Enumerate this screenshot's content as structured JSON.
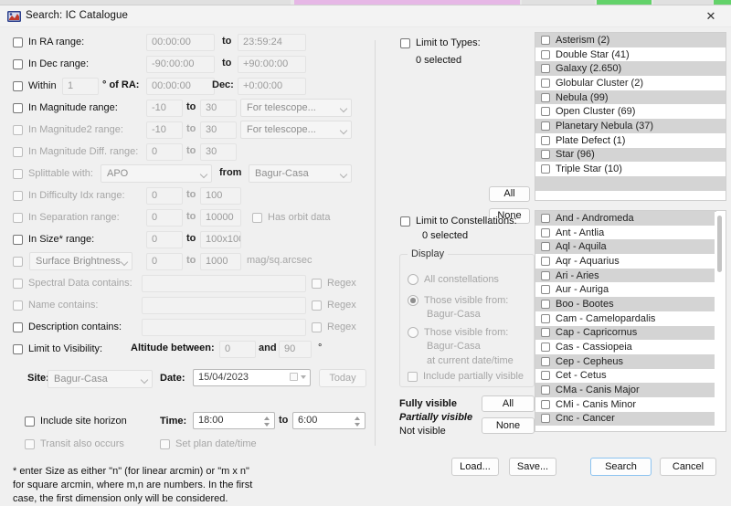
{
  "window": {
    "title": "Search: IC Catalogue",
    "close_label": "✕",
    "app_icon": "catalogue-icon"
  },
  "left": {
    "ra_range": {
      "label": "In RA range:",
      "from": "00:00:00",
      "to_label": "to",
      "to": "23:59:24",
      "enabled": true
    },
    "dec_range": {
      "label": "In Dec range:",
      "from": "-90:00:00",
      "to_label": "to",
      "to": "+90:00:00",
      "enabled": true
    },
    "within": {
      "label": "Within",
      "deg": "1",
      "of_ra_label": "° of RA:",
      "ra": "00:00:00",
      "dec_label": "Dec:",
      "dec": "+0:00:00",
      "enabled": true
    },
    "magnitude": {
      "label": "In Magnitude range:",
      "from": "-10",
      "to_label": "to",
      "to": "30",
      "telescope": "For telescope...",
      "enabled": true
    },
    "magnitude2": {
      "label": "In Magnitude2 range:",
      "from": "-10",
      "to_label": "to",
      "to": "30",
      "telescope": "For telescope...",
      "enabled": false
    },
    "magnitude_diff": {
      "label": "In Magnitude Diff. range:",
      "from": "0",
      "to_label": "to",
      "to": "30",
      "enabled": false
    },
    "splittable": {
      "label": "Splittable with:",
      "scope": "APO",
      "from_label": "from",
      "site": "Bagur-Casa",
      "enabled": false
    },
    "difficulty": {
      "label": "In Difficulty Idx range:",
      "from": "0",
      "to_label": "to",
      "to": "100",
      "enabled": false
    },
    "separation": {
      "label": "In Separation range:",
      "from": "0",
      "to_label": "to",
      "to": "10000",
      "orbit_label": "Has orbit data",
      "enabled": false
    },
    "size": {
      "label": "In Size* range:",
      "from": "0",
      "to_label": "to",
      "to": "100x100",
      "enabled": true
    },
    "surface": {
      "label": "Surface Brightness",
      "from": "0",
      "to_label": "to",
      "to": "1000",
      "units": "mag/sq.arcsec",
      "enabled": false
    },
    "spectral": {
      "label": "Spectral Data contains:",
      "value": "",
      "regex_label": "Regex",
      "enabled": false
    },
    "name": {
      "label": "Name contains:",
      "value": "",
      "regex_label": "Regex",
      "enabled": false
    },
    "description": {
      "label": "Description contains:",
      "value": "",
      "regex_label": "Regex",
      "enabled": true
    },
    "visibility": {
      "label": "Limit to Visibility:",
      "altitude_label": "Altitude between:",
      "alt_min": "0",
      "and_label": "and",
      "alt_max": "90",
      "deg_label": "°",
      "enabled": true
    },
    "site": {
      "label": "Site:",
      "value": "Bagur-Casa"
    },
    "date": {
      "label": "Date:",
      "value": "15/04/2023",
      "today_label": "Today"
    },
    "site_horizon": {
      "label": "Include site horizon",
      "enabled": true
    },
    "time": {
      "label": "Time:",
      "from": "18:00",
      "to_label": "to",
      "to": "6:00"
    },
    "transit": {
      "label": "Transit also occurs",
      "enabled": false
    },
    "set_plan": {
      "label": "Set plan date/time",
      "enabled": false
    },
    "footnote": "* enter Size as either \"n\" (for linear arcmin) or \"m x n\"\nfor square arcmin, where m,n are numbers. In the first\ncase, the first dimension only will be considered."
  },
  "types_panel": {
    "label": "Limit to Types:",
    "selected_text": "0 selected",
    "all_label": "All",
    "none_label": "None",
    "items": [
      "Asterism (2)",
      "Double Star (41)",
      "Galaxy (2.650)",
      "Globular Cluster (2)",
      "Nebula (99)",
      "Open Cluster (69)",
      "Planetary Nebula (37)",
      "Plate Defect (1)",
      "Star (96)",
      "Triple Star (10)"
    ]
  },
  "constellations_panel": {
    "label": "Limit to Constellations:",
    "selected_text": "0 selected",
    "display_group_title": "Display",
    "opt_all": "All constellations",
    "opt_visible_from": "Those visible from:",
    "opt_visible_from_site": "Bagur-Casa",
    "opt_visible_now": "Those visible from:",
    "opt_visible_now_site": "Bagur-Casa",
    "opt_visible_now_sub": "at current date/time",
    "include_partial": "Include partially visible",
    "legend_full": "Fully visible",
    "legend_partial": "Partially visible",
    "legend_not": "Not visible",
    "all_label": "All",
    "none_label": "None",
    "items": [
      "And - Andromeda",
      "Ant - Antlia",
      "Aql - Aquila",
      "Aqr - Aquarius",
      "Ari - Aries",
      "Aur - Auriga",
      "Boo - Bootes",
      "Cam - Camelopardalis",
      "Cap - Capricornus",
      "Cas - Cassiopeia",
      "Cep - Cepheus",
      "Cet - Cetus",
      "CMa - Canis Major",
      "CMi - Canis Minor",
      "Cnc - Cancer"
    ]
  },
  "footer": {
    "load_label": "Load...",
    "save_label": "Save...",
    "search_label": "Search",
    "cancel_label": "Cancel"
  },
  "colors": {
    "window_bg": "#f0f0f0",
    "list_alt_row": "#d4d4d4",
    "default_button_border": "#8cc3f0",
    "tab_green": "#63d26a",
    "tab_pink": "#e6b7e6"
  }
}
